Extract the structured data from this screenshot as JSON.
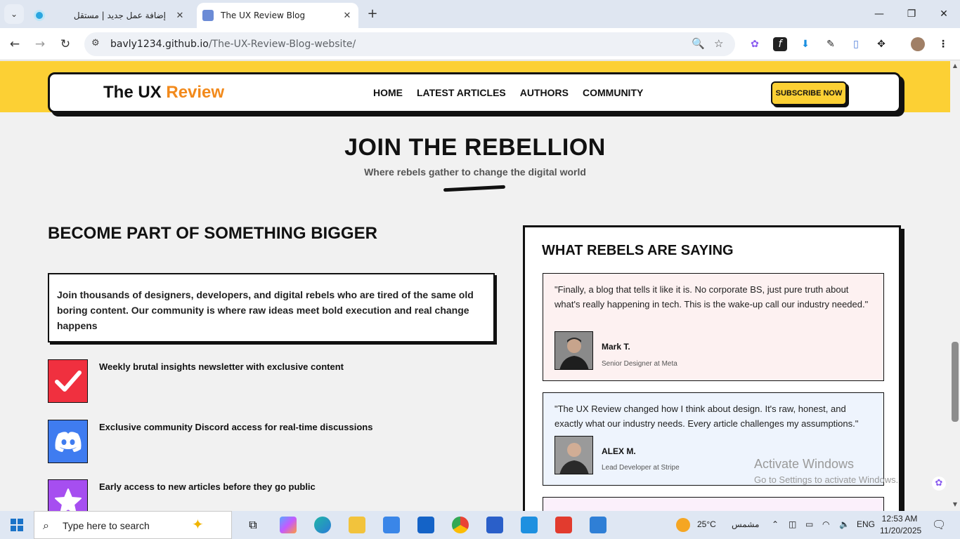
{
  "browser": {
    "tabs": [
      {
        "title": "إضافة عمل جديد | مستقل",
        "active": false
      },
      {
        "title": "The UX Review Blog",
        "active": true
      }
    ],
    "url_host": "bavly1234.github.io",
    "url_path": "/The-UX-Review-Blog-website/"
  },
  "site": {
    "logo_main": "The UX",
    "logo_accent": "Review",
    "nav": [
      "HOME",
      "LATEST ARTICLES",
      "AUTHORS",
      "COMMUNITY"
    ],
    "subscribe_label": "SUBSCRIBE NOW"
  },
  "hero": {
    "title": "JOIN THE REBELLION",
    "subtitle": "Where rebels gather to change the digital world"
  },
  "community": {
    "heading": "BECOME PART OF SOMETHING BIGGER",
    "intro": "Join thousands of designers, developers, and digital rebels who are tired of the same old boring content. Our community is where raw ideas meet bold execution and real change happens",
    "features": [
      {
        "text": "Weekly brutal insights newsletter with exclusive content",
        "icon": "check-icon",
        "color": "#f0303f"
      },
      {
        "text": "Exclusive community Discord access for real-time discussions",
        "icon": "discord-icon",
        "color": "#3f7cf0"
      },
      {
        "text": "Early access to new articles before they go public",
        "icon": "star-icon",
        "color": "#a64ef0"
      }
    ]
  },
  "testimonials": {
    "heading": "WHAT REBELS ARE SAYING",
    "items": [
      {
        "quote": "\"Finally, a blog that tells it like it is. No corporate BS, just pure truth about what's really happening in tech. This is the wake-up call our industry needed.\"",
        "name": "Mark T.",
        "role": "Senior Designer at Meta",
        "bg": "#fdf1f1"
      },
      {
        "quote": "\"The UX Review changed how I think about design. It's raw, honest, and exactly what our industry needs. Every article challenges my assumptions.\"",
        "name": "ALEX M.",
        "role": "Lead Developer at Stripe",
        "bg": "#eef4fd"
      },
      {
        "quote": "",
        "name": "",
        "role": "",
        "bg": "#fbf0fb"
      }
    ]
  },
  "watermark": {
    "line1": "Activate Windows",
    "line2": "Go to Settings to activate Windows."
  },
  "taskbar": {
    "search_placeholder": "Type here to search",
    "weather": "25°C",
    "weather_label": "مشمس",
    "language": "ENG",
    "time": "12:53 AM",
    "date": "11/20/2025"
  }
}
